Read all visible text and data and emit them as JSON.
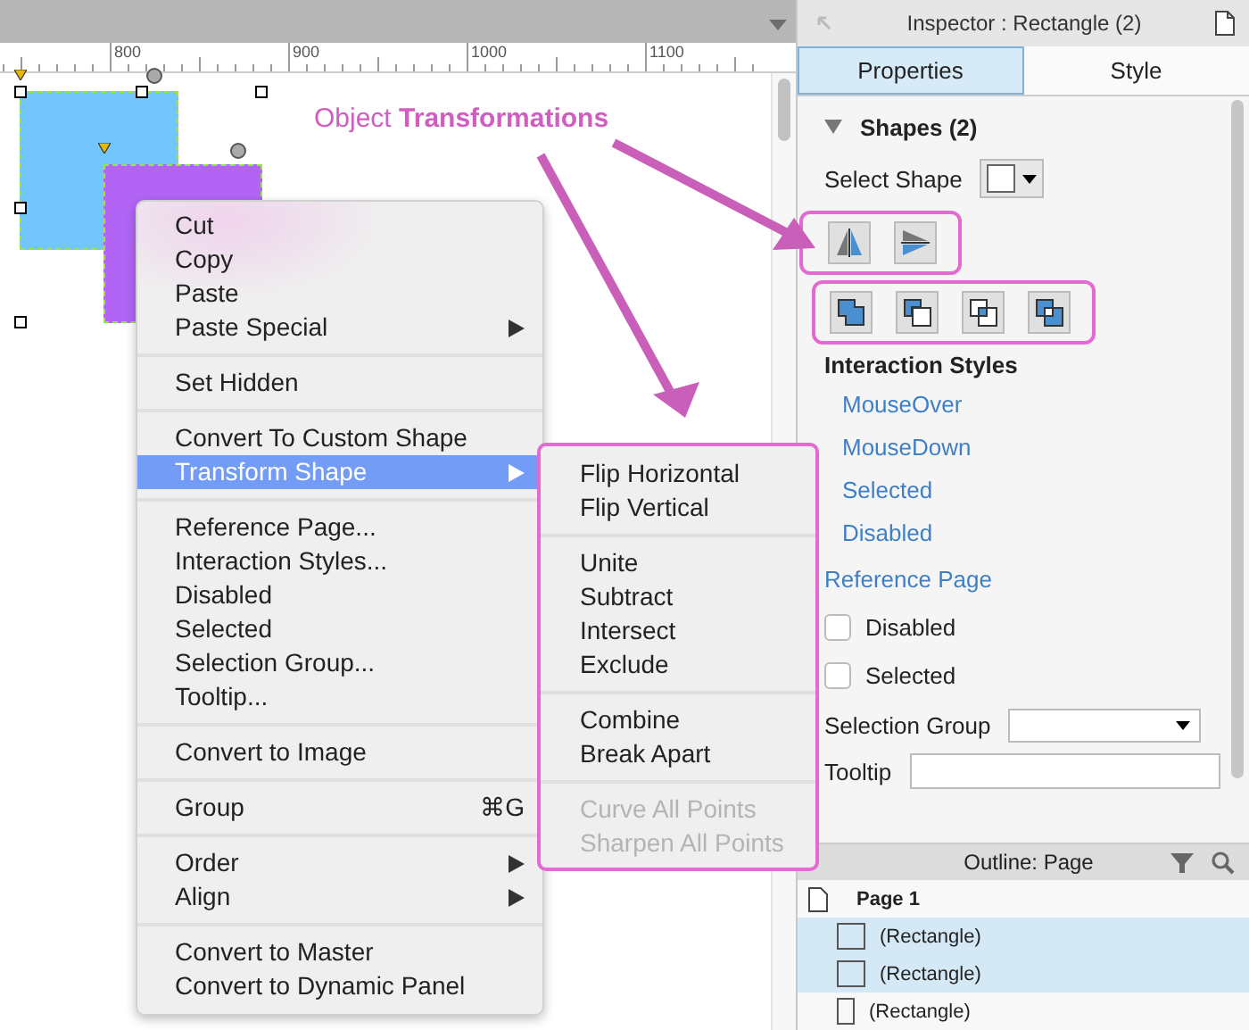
{
  "canvas": {
    "ruler_labels": [
      "800",
      "900",
      "1000",
      "1100"
    ],
    "shapes": [
      {
        "color": "#73c6fb"
      },
      {
        "color": "#b265f5"
      }
    ]
  },
  "annotation": {
    "text": "Object **Transformations**"
  },
  "context_menu": {
    "groups": [
      {
        "items": [
          {
            "label": "Cut",
            "submenu": false,
            "selected": false
          },
          {
            "label": "Copy",
            "submenu": false,
            "selected": false
          },
          {
            "label": "Paste",
            "submenu": false,
            "selected": false
          },
          {
            "label": "Paste Special",
            "submenu": true,
            "selected": false
          }
        ]
      },
      {
        "items": [
          {
            "label": "Set Hidden",
            "submenu": false,
            "selected": false
          }
        ]
      },
      {
        "items": [
          {
            "label": "Convert To Custom Shape",
            "submenu": false,
            "selected": false
          },
          {
            "label": "Transform Shape",
            "submenu": true,
            "selected": true
          }
        ]
      },
      {
        "items": [
          {
            "label": "Reference Page...",
            "submenu": false,
            "selected": false
          },
          {
            "label": "Interaction Styles...",
            "submenu": false,
            "selected": false
          },
          {
            "label": "Disabled",
            "submenu": false,
            "selected": false
          },
          {
            "label": "Selected",
            "submenu": false,
            "selected": false
          },
          {
            "label": "Selection Group...",
            "submenu": false,
            "selected": false
          },
          {
            "label": "Tooltip...",
            "submenu": false,
            "selected": false
          }
        ]
      },
      {
        "items": [
          {
            "label": "Convert to Image",
            "submenu": false,
            "selected": false
          }
        ]
      },
      {
        "items": [
          {
            "label": "Group",
            "shortcut": "⌘G",
            "submenu": false,
            "selected": false
          }
        ]
      },
      {
        "items": [
          {
            "label": "Order",
            "submenu": true,
            "selected": false
          },
          {
            "label": "Align",
            "submenu": true,
            "selected": false
          }
        ]
      },
      {
        "items": [
          {
            "label": "Convert to Master",
            "submenu": false,
            "selected": false
          },
          {
            "label": "Convert to Dynamic Panel",
            "submenu": false,
            "selected": false
          }
        ]
      }
    ]
  },
  "submenu": {
    "groups": [
      {
        "items": [
          {
            "label": "Flip Horizontal",
            "disabled": false
          },
          {
            "label": "Flip Vertical",
            "disabled": false
          }
        ]
      },
      {
        "items": [
          {
            "label": "Unite",
            "disabled": false
          },
          {
            "label": "Subtract",
            "disabled": false
          },
          {
            "label": "Intersect",
            "disabled": false
          },
          {
            "label": "Exclude",
            "disabled": false
          }
        ]
      },
      {
        "items": [
          {
            "label": "Combine",
            "disabled": false
          },
          {
            "label": "Break Apart",
            "disabled": false
          }
        ]
      },
      {
        "items": [
          {
            "label": "Curve All Points",
            "disabled": true
          },
          {
            "label": "Sharpen All Points",
            "disabled": true
          }
        ]
      }
    ]
  },
  "inspector": {
    "title": "Inspector : Rectangle (2)",
    "tabs": [
      {
        "label": "Properties",
        "selected": true
      },
      {
        "label": "Style",
        "selected": false
      }
    ],
    "section": {
      "title": "Shapes (2)",
      "expanded": true
    },
    "select_shape_label": "Select Shape",
    "interaction_title": "Interaction Styles",
    "interaction_links": [
      "MouseOver",
      "MouseDown",
      "Selected",
      "Disabled"
    ],
    "reference_page": "Reference Page",
    "checkboxes": [
      {
        "label": "Disabled",
        "checked": false
      },
      {
        "label": "Selected",
        "checked": false
      }
    ],
    "selection_group_label": "Selection Group",
    "tooltip_label": "Tooltip"
  },
  "outline": {
    "title": "Outline: Page",
    "page": "Page 1",
    "rows": [
      {
        "label": "(Rectangle)",
        "selected": true
      },
      {
        "label": "(Rectangle)",
        "selected": true
      },
      {
        "label": "(Rectangle)",
        "selected": false
      }
    ]
  }
}
